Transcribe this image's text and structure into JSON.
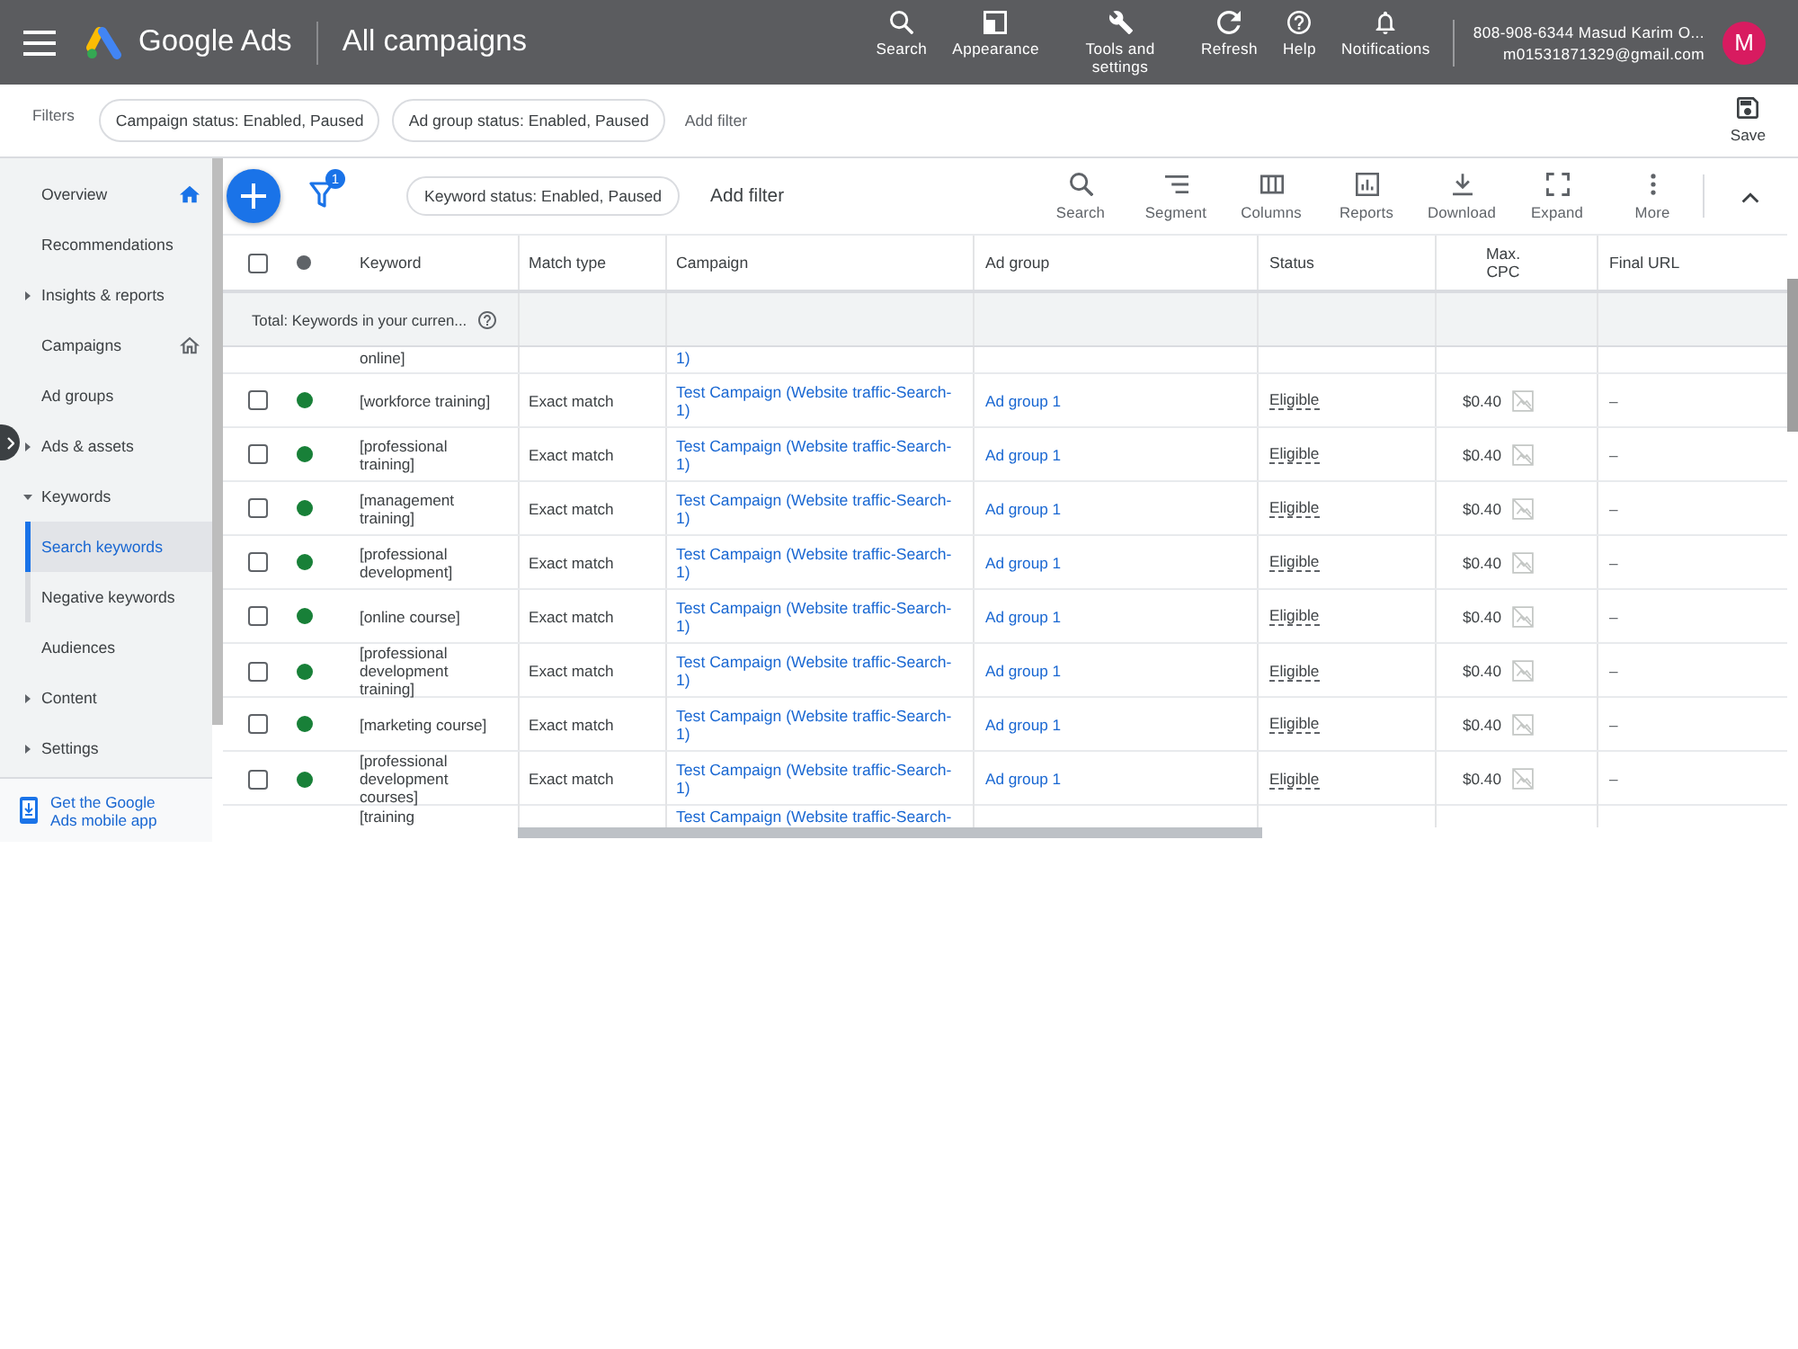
{
  "header": {
    "app_name": "Google Ads",
    "page_title": "All campaigns",
    "actions": [
      "Search",
      "Appearance",
      "Tools and settings",
      "Refresh",
      "Help",
      "Notifications"
    ],
    "account": {
      "name": "808-908-6344 Masud Karim O...",
      "email": "m01531871329@gmail.com",
      "avatar_letter": "M"
    }
  },
  "filter_bar": {
    "label": "Filters",
    "chips": [
      "Campaign status: Enabled, Paused",
      "Ad group status: Enabled, Paused"
    ],
    "add_filter": "Add filter",
    "save": "Save"
  },
  "sidebar": {
    "items": [
      {
        "label": "Overview",
        "selected": false,
        "home_page": true
      },
      {
        "label": "Recommendations",
        "selected": false
      },
      {
        "label": "Insights & reports",
        "selected": false,
        "expanded": false
      },
      {
        "label": "Campaigns",
        "selected": false,
        "home_page": false
      },
      {
        "label": "Ad groups",
        "selected": false
      },
      {
        "label": "Ads & assets",
        "selected": false,
        "expanded": false
      },
      {
        "label": "Keywords",
        "selected": false,
        "expanded": true,
        "children": [
          {
            "label": "Search keywords",
            "selected": true
          },
          {
            "label": "Negative keywords",
            "selected": false
          }
        ]
      },
      {
        "label": "Audiences",
        "selected": false
      },
      {
        "label": "Content",
        "selected": false,
        "expanded": false
      },
      {
        "label": "Settings",
        "selected": false,
        "expanded": false
      }
    ],
    "mobile_app_link": "Get the Google Ads mobile app"
  },
  "toolbar": {
    "filter_count": "1",
    "chips": [
      "Keyword status: Enabled, Paused"
    ],
    "add_filter": "Add filter",
    "tools": [
      "Search",
      "Segment",
      "Columns",
      "Reports",
      "Download",
      "Expand",
      "More"
    ]
  },
  "table": {
    "select_all_checked": false,
    "columns": [
      "Keyword",
      "Match type",
      "Campaign",
      "Ad group",
      "Status",
      "Max. CPC",
      "Final URL"
    ],
    "total_label": "Total: Keywords in your curren...",
    "rows": [
      {
        "kind": "cut_top",
        "keyword": "online]",
        "campaign": "1)"
      },
      {
        "kind": "full",
        "checked": false,
        "enabled": true,
        "keyword": "[workforce training]",
        "match_type": "Exact match",
        "campaign": "Test Campaign (Website traffic-Search-1)",
        "ad_group": "Ad group 1",
        "status": "Eligible",
        "max_cpc": "$0.40",
        "final_url": "–"
      },
      {
        "kind": "full",
        "checked": false,
        "enabled": true,
        "keyword": "[professional training]",
        "match_type": "Exact match",
        "campaign": "Test Campaign (Website traffic-Search-1)",
        "ad_group": "Ad group 1",
        "status": "Eligible",
        "max_cpc": "$0.40",
        "final_url": "–"
      },
      {
        "kind": "full",
        "checked": false,
        "enabled": true,
        "keyword": "[management training]",
        "match_type": "Exact match",
        "campaign": "Test Campaign (Website traffic-Search-1)",
        "ad_group": "Ad group 1",
        "status": "Eligible",
        "max_cpc": "$0.40",
        "final_url": "–"
      },
      {
        "kind": "full",
        "checked": false,
        "enabled": true,
        "keyword": "[professional development]",
        "match_type": "Exact match",
        "campaign": "Test Campaign (Website traffic-Search-1)",
        "ad_group": "Ad group 1",
        "status": "Eligible",
        "max_cpc": "$0.40",
        "final_url": "–"
      },
      {
        "kind": "full",
        "checked": false,
        "enabled": true,
        "keyword": "[online course]",
        "match_type": "Exact match",
        "campaign": "Test Campaign (Website traffic-Search-1)",
        "ad_group": "Ad group 1",
        "status": "Eligible",
        "max_cpc": "$0.40",
        "final_url": "–"
      },
      {
        "kind": "full",
        "checked": false,
        "enabled": true,
        "keyword": "[professional development training]",
        "match_type": "Exact match",
        "campaign": "Test Campaign (Website traffic-Search-1)",
        "ad_group": "Ad group 1",
        "status": "Eligible",
        "max_cpc": "$0.40",
        "final_url": "–"
      },
      {
        "kind": "full",
        "checked": false,
        "enabled": true,
        "keyword": "[marketing course]",
        "match_type": "Exact match",
        "campaign": "Test Campaign (Website traffic-Search-1)",
        "ad_group": "Ad group 1",
        "status": "Eligible",
        "max_cpc": "$0.40",
        "final_url": "–"
      },
      {
        "kind": "full",
        "checked": false,
        "enabled": true,
        "keyword": "[professional development courses]",
        "match_type": "Exact match",
        "campaign": "Test Campaign (Website traffic-Search-1)",
        "ad_group": "Ad group 1",
        "status": "Eligible",
        "max_cpc": "$0.40",
        "final_url": "–"
      },
      {
        "kind": "cut_bottom",
        "keyword": "[training",
        "campaign": "Test Campaign (Website traffic-Search-"
      }
    ]
  }
}
